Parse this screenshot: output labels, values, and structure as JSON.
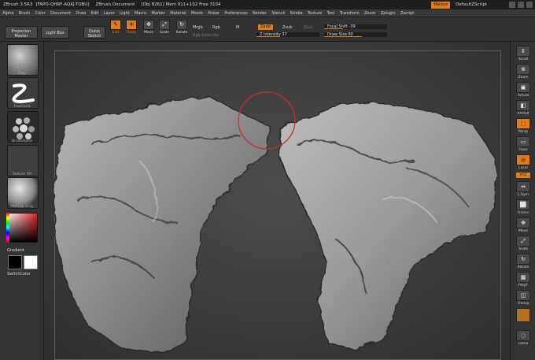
{
  "titlebar": {
    "app": "ZBrush 3.5R3",
    "id": "[FAPO-QHRF-AQKJ-TOBU]",
    "document": "ZBrush Document",
    "stats": "[Obj 8261]  Mem 911+102  Free 3104",
    "menus": "Menus",
    "script": "DefaultZScript"
  },
  "menus": [
    "Alpha",
    "Brush",
    "Color",
    "Document",
    "Draw",
    "Edit",
    "Layer",
    "Light",
    "Macro",
    "Marker",
    "Material",
    "Movie",
    "Picker",
    "Preferences",
    "Render",
    "Stencil",
    "Stroke",
    "Texture",
    "Tool",
    "Transform",
    "Zoom",
    "Zplugin",
    "Zscript"
  ],
  "shelf": {
    "projection_master": "Projection Master",
    "light_box": "Light Box",
    "quick_sketch": "Quick Sketch",
    "tools": [
      {
        "label": "Edit",
        "glyph": "✎"
      },
      {
        "label": "Draw",
        "glyph": "✛"
      },
      {
        "label": "Move",
        "glyph": "✥"
      },
      {
        "label": "Scale",
        "glyph": "⤢"
      },
      {
        "label": "Rotate",
        "glyph": "↻"
      }
    ],
    "mrgb": "Mrgb",
    "rgb": "Rgb",
    "m": "M",
    "rgb_intensity": "Rgb Intensity",
    "zadd": "Zadd",
    "zsub": "Zsub",
    "zcut": "Zcut",
    "z_intensity": "Z Intensity 37",
    "focal_shift": "Focal Shift -39",
    "draw_size": "Draw Size 80"
  },
  "left": {
    "brush1": "Clay",
    "brush2": "Freehand",
    "brush3": "BrushAlpha",
    "brush4": "Texture Off",
    "material": "MatCap Gray",
    "gradient": "Gradient",
    "switch_color": "SwitchColor"
  },
  "right": [
    {
      "label": "Scroll",
      "glyph": "⇕"
    },
    {
      "label": "Zoom",
      "glyph": "⊕"
    },
    {
      "label": "Actual",
      "glyph": "▣"
    },
    {
      "label": "AAHalf",
      "glyph": "◧"
    },
    {
      "label": "Persp",
      "glyph": "⬚"
    },
    {
      "label": "Floor",
      "glyph": "▭"
    },
    {
      "label": "Local",
      "glyph": "◎"
    },
    {
      "label": "XYZ",
      "glyph": ""
    },
    {
      "label": "L.Sym",
      "glyph": "⇔"
    },
    {
      "label": "Frame",
      "glyph": "⬜"
    },
    {
      "label": "Move",
      "glyph": "✥"
    },
    {
      "label": "Scale",
      "glyph": "⤢"
    },
    {
      "label": "Rotate",
      "glyph": "↻"
    },
    {
      "label": "PolyF",
      "glyph": "▦"
    },
    {
      "label": "Transp",
      "glyph": "◫"
    },
    {
      "label": "",
      "glyph": ""
    },
    {
      "label": "Lasso",
      "glyph": "◌"
    }
  ],
  "colors": {
    "accent": "#e07d1a",
    "cursor": "#c23030"
  }
}
